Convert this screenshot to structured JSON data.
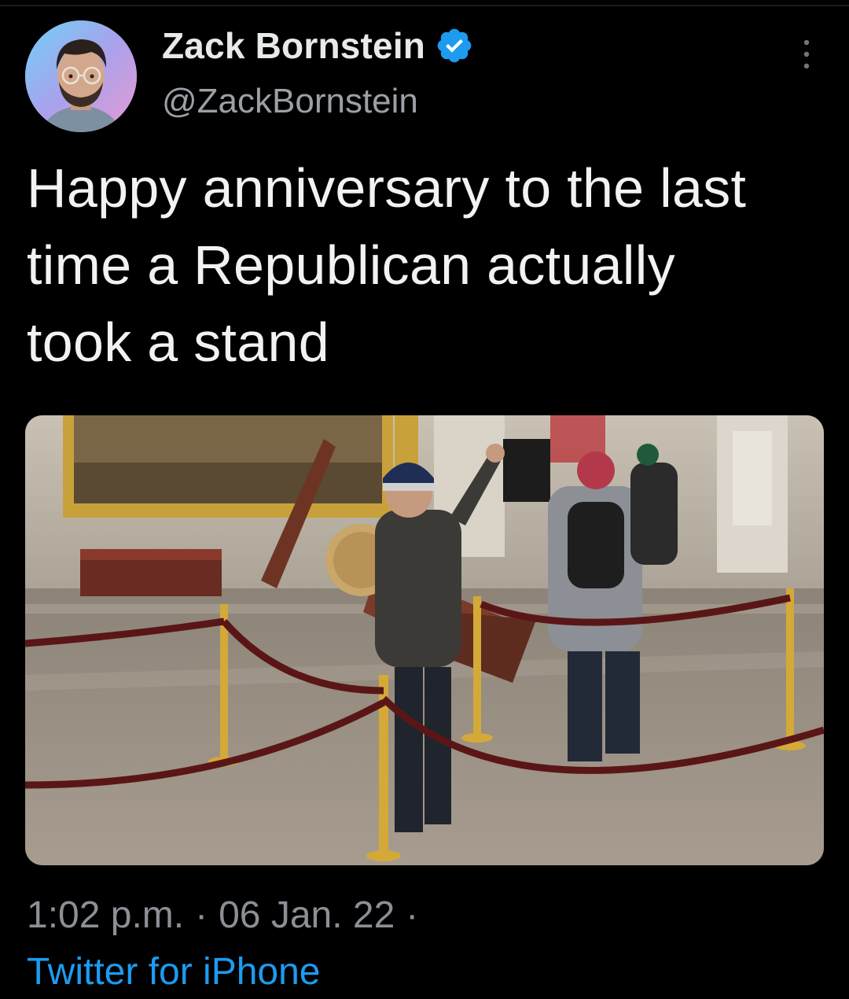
{
  "tweet": {
    "author": {
      "display_name": "Zack Bornstein",
      "handle": "@ZackBornstein",
      "verified": true
    },
    "text_lines": [
      "Happy anniversary to the last",
      "time a Republican actually",
      "took a stand"
    ],
    "timestamp": {
      "time": "1:02 p.m.",
      "separator": "·",
      "date": "06 Jan. 22",
      "trailing_separator": "·"
    },
    "source": "Twitter for iPhone"
  },
  "colors": {
    "background": "#000000",
    "text_primary": "#e7e9ea",
    "text_secondary": "#8b9096",
    "link_blue": "#1d9bf0",
    "verified_blue": "#1d9bf0"
  },
  "icons": {
    "verified": "verified-badge-icon",
    "more": "more-vertical-icon"
  }
}
